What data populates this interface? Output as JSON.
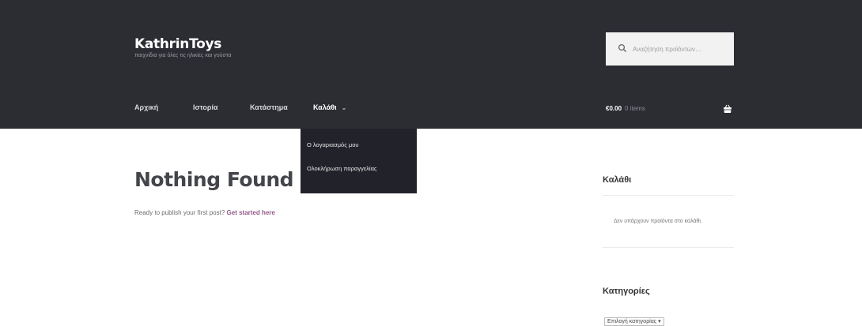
{
  "site": {
    "title": "KathrinToys",
    "description": "παιχνίδια για όλες τις ηλικίες και γούστα"
  },
  "search": {
    "placeholder": "Αναζήτηση προϊόντων…",
    "icon": "search-icon"
  },
  "nav": {
    "items": [
      {
        "label": "Αρχική"
      },
      {
        "label": "Ιστορία"
      },
      {
        "label": "Κατάστημα"
      },
      {
        "label": "Καλάθι",
        "active": true,
        "has_dropdown": true
      }
    ],
    "chevron_icon": "chevron-down-icon",
    "dropdown": {
      "items": [
        {
          "label": "Ο λογαριασμός μου"
        },
        {
          "label": "Ολοκλήρωση παραγγελίας"
        }
      ]
    }
  },
  "cart": {
    "amount": "€0.00",
    "items": "0 items",
    "icon": "basket-icon"
  },
  "main": {
    "title": "Nothing Found",
    "lead_text": "Ready to publish your first post? ",
    "lead_link": "Get started here"
  },
  "sidebar": {
    "cart_title": "Καλάθι",
    "cart_empty": "Δεν υπάρχουν προϊόντα στο καλάθι.",
    "categories_title": "Κατηγορίες",
    "categories_select": "Επιλογή κατηγορίας"
  },
  "colors": {
    "header_bg": "#2c2d33",
    "dropdown_bg": "#22232a",
    "link_accent": "#96588a",
    "title_text": "#43454b"
  }
}
